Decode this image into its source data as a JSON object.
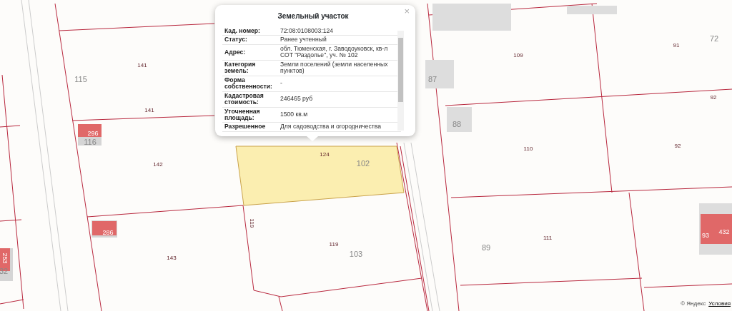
{
  "popup": {
    "title": "Земельный участок",
    "fields": [
      {
        "label": "Кад. номер:",
        "value": "72:08:0108003:124"
      },
      {
        "label": "Статус:",
        "value": "Ранее учтенный"
      },
      {
        "label": "Адрес:",
        "value": "обл. Тюменская, г. Заводоуковск, кв-л СОТ \"Раздолье\", уч. № 102"
      },
      {
        "label": "Категория земель:",
        "value": "Земли поселений (земли населенных пунктов)"
      },
      {
        "label": "Форма собственности:",
        "value": "-"
      },
      {
        "label": "Кадастровая стоимость:",
        "value": "246465 руб"
      },
      {
        "label": "Уточненная площадь:",
        "value": "1500 кв.м"
      },
      {
        "label": "Разрешенное",
        "value": "Для садоводства и огородничества"
      }
    ],
    "close": "×"
  },
  "map_labels": [
    {
      "kind": "parcel",
      "text": "141"
    },
    {
      "kind": "house",
      "text": "115"
    },
    {
      "kind": "parcel",
      "text": "141"
    },
    {
      "kind": "building",
      "text": "296"
    },
    {
      "kind": "house",
      "text": "116"
    },
    {
      "kind": "parcel",
      "text": "142"
    },
    {
      "kind": "building",
      "text": "286"
    },
    {
      "kind": "parcel",
      "text": "143"
    },
    {
      "kind": "building",
      "text": "253"
    },
    {
      "kind": "house",
      "text": "32"
    },
    {
      "kind": "parcel",
      "text": "124"
    },
    {
      "kind": "house",
      "text": "102"
    },
    {
      "kind": "parcel",
      "text": "119"
    },
    {
      "kind": "parcel",
      "text": "119"
    },
    {
      "kind": "house",
      "text": "103"
    },
    {
      "kind": "house",
      "text": "87"
    },
    {
      "kind": "parcel",
      "text": "109"
    },
    {
      "kind": "house",
      "text": "88"
    },
    {
      "kind": "parcel",
      "text": "110"
    },
    {
      "kind": "house",
      "text": "72"
    },
    {
      "kind": "parcel",
      "text": "91"
    },
    {
      "kind": "parcel",
      "text": "92"
    },
    {
      "kind": "parcel",
      "text": "92"
    },
    {
      "kind": "parcel",
      "text": "111"
    },
    {
      "kind": "house",
      "text": "89"
    },
    {
      "kind": "building",
      "text": "93"
    },
    {
      "kind": "building",
      "text": "432"
    }
  ],
  "attribution": {
    "copyright": "© Яндекс",
    "link": "Условия"
  }
}
